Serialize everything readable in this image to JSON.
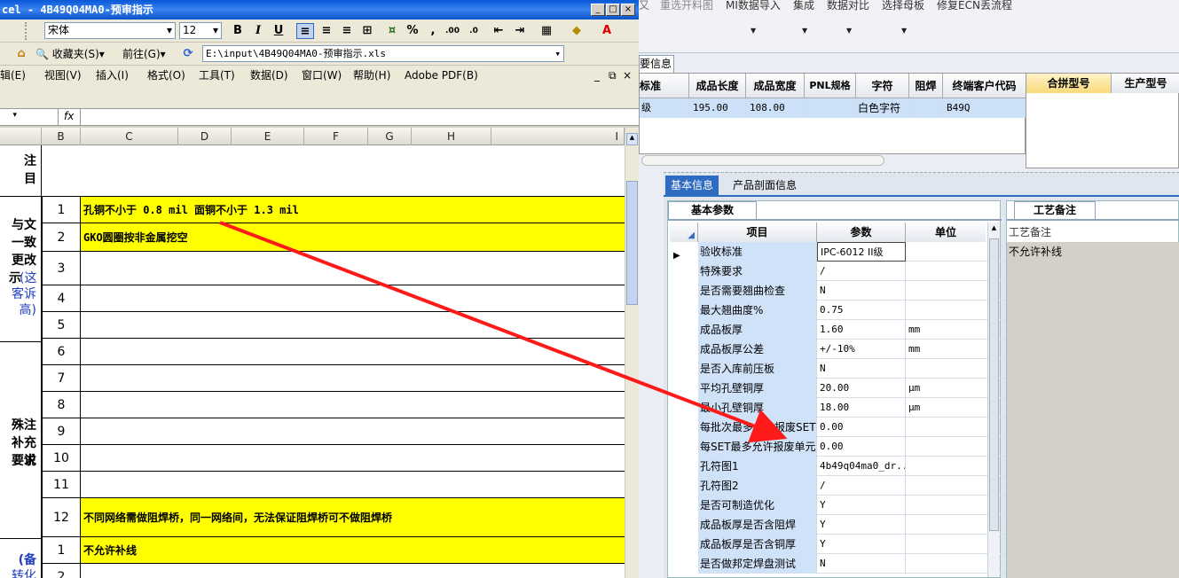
{
  "excel": {
    "title": "cel - 4B49Q04MA0-预审指示",
    "font_name": "宋体",
    "font_size": "12",
    "favorites": "收藏夹(S)",
    "goto": "前往(G)",
    "path": "E:\\input\\4B49Q04MA0-预审指示.xls",
    "menu": [
      "辑(E)",
      "视图(V)",
      "插入(I)",
      "格式(O)",
      "工具(T)",
      "数据(D)",
      "窗口(W)",
      "帮助(H)",
      "Adobe PDF(B)"
    ],
    "fx": "fx",
    "columns": [
      "B",
      "C",
      "D",
      "E",
      "F",
      "G",
      "H",
      "I"
    ],
    "col_a_texts": [
      "与文",
      "一致",
      "更改",
      "示",
      "(这",
      "客诉",
      "高)",
      "殊注",
      "补充说",
      "要求",
      "(备",
      "转化"
    ],
    "col_a_top": [
      "注",
      "目"
    ],
    "rows": [
      {
        "n": "1",
        "text": "孔铜不小于 0.8 mil  面铜不小于 1.3 mil",
        "hl": true
      },
      {
        "n": "2",
        "text": "GKO圆圈按非金属挖空",
        "hl": true
      },
      {
        "n": "3",
        "text": "",
        "hl": false
      },
      {
        "n": "4",
        "text": "",
        "hl": false
      },
      {
        "n": "5",
        "text": "",
        "hl": false
      },
      {
        "n": "6",
        "text": "",
        "hl": false
      },
      {
        "n": "7",
        "text": "",
        "hl": false
      },
      {
        "n": "8",
        "text": "",
        "hl": false
      },
      {
        "n": "9",
        "text": "",
        "hl": false
      },
      {
        "n": "10",
        "text": "",
        "hl": false
      },
      {
        "n": "11",
        "text": "",
        "hl": false
      },
      {
        "n": "12",
        "text": "不同网络需做阻焊桥，同一网络间，无法保证阻焊桥可不做阻焊桥",
        "hl": true
      },
      {
        "n": "1",
        "text": "不允许补线",
        "hl": true
      },
      {
        "n": "2",
        "text": "",
        "hl": false
      }
    ]
  },
  "app": {
    "top_menu": [
      "重选开料图",
      "MI数据导入",
      "集成",
      "数据对比",
      "选择母板",
      "修复ECN丢流程"
    ],
    "tab1": "要信息",
    "grid1_headers": [
      "标准",
      "成品长度",
      "成品宽度",
      "PNL规格",
      "字符",
      "阻焊",
      "终端客户代码"
    ],
    "grid1_row": [
      "级",
      "195.00",
      "108.00",
      "",
      "白色字符",
      "",
      "B49Q"
    ],
    "grid2_headers": [
      "合拼型号",
      "生产型号"
    ],
    "tabs": [
      "基本信息",
      "产品剖面信息"
    ],
    "subtab_params": "基本参数",
    "subtab_notes": "工艺备注",
    "param_headers": [
      "项目",
      "参数",
      "单位"
    ],
    "params": [
      {
        "name": "验收标准",
        "value": "IPC-6012 II级",
        "unit": ""
      },
      {
        "name": "特殊要求",
        "value": "/",
        "unit": ""
      },
      {
        "name": "是否需要翘曲检查",
        "value": "N",
        "unit": ""
      },
      {
        "name": "最大翘曲度%",
        "value": "0.75",
        "unit": ""
      },
      {
        "name": "成品板厚",
        "value": "1.60",
        "unit": "mm"
      },
      {
        "name": "成品板厚公差",
        "value": "+/-10%",
        "unit": "mm"
      },
      {
        "name": "是否入库前压板",
        "value": "N",
        "unit": ""
      },
      {
        "name": "平均孔壁铜厚",
        "value": "20.00",
        "unit": "μm"
      },
      {
        "name": "最小孔壁铜厚",
        "value": "18.00",
        "unit": "μm"
      },
      {
        "name": "每批次最多允许报废SET",
        "value": "0.00",
        "unit": ""
      },
      {
        "name": "每SET最多允许报废单元",
        "value": "0.00",
        "unit": ""
      },
      {
        "name": "孔符图1",
        "value": "4b49q04ma0_dr...",
        "unit": ""
      },
      {
        "name": "孔符图2",
        "value": "/",
        "unit": ""
      },
      {
        "name": "是否可制造优化",
        "value": "Y",
        "unit": ""
      },
      {
        "name": "成品板厚是否含阻焊",
        "value": "Y",
        "unit": ""
      },
      {
        "name": "成品板厚是否含铜厚",
        "value": "Y",
        "unit": ""
      },
      {
        "name": "是否做邦定焊盘测试",
        "value": "N",
        "unit": ""
      }
    ],
    "notes_header": "工艺备注",
    "notes_value": "不允许补线"
  },
  "colors": {
    "highlight": "#ffff00",
    "arrow": "#ff1a1a",
    "selected_row": "#cce0f8"
  }
}
